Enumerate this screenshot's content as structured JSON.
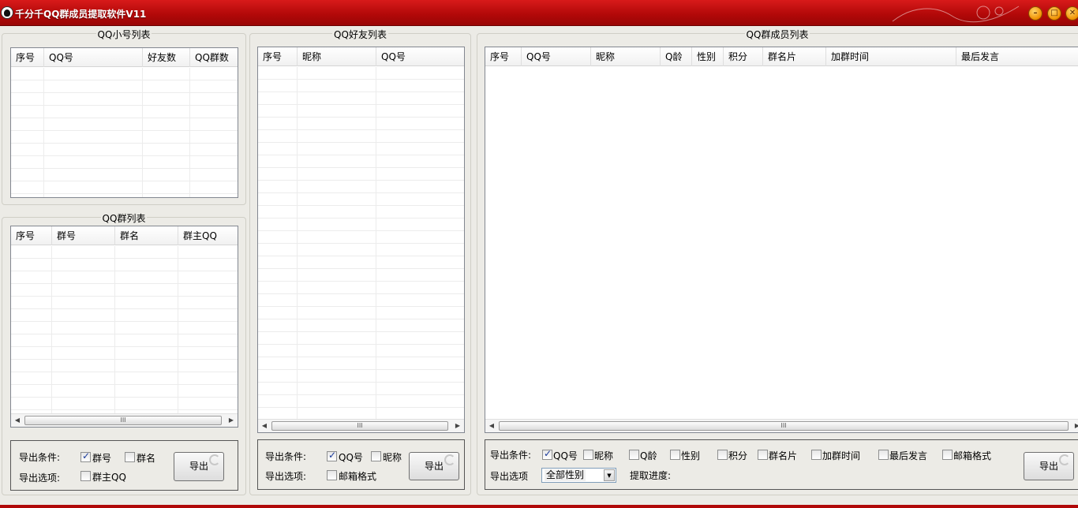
{
  "window": {
    "title": "千分千QQ群成员提取软件V11",
    "icon": "qq-penguin-icon",
    "accent": "#c00c0c"
  },
  "small_account_list": {
    "title": "QQ小号列表",
    "columns": [
      "序号",
      "QQ号",
      "好友数",
      "QQ群数"
    ],
    "rows": []
  },
  "group_list": {
    "title": "QQ群列表",
    "columns": [
      "序号",
      "群号",
      "群名",
      "群主QQ"
    ],
    "rows": [],
    "scroll_thumb": "III",
    "export": {
      "condition_label": "导出条件:",
      "option_label": "导出选项:",
      "checks": [
        {
          "label": "群号",
          "checked": true
        },
        {
          "label": "群名",
          "checked": false
        },
        {
          "label": "群主QQ",
          "checked": false
        }
      ],
      "button": "导出"
    }
  },
  "friend_list": {
    "title": "QQ好友列表",
    "columns": [
      "序号",
      "昵称",
      "QQ号"
    ],
    "rows": [],
    "scroll_thumb": "III",
    "export": {
      "condition_label": "导出条件:",
      "option_label": "导出选项:",
      "checks": [
        {
          "label": "QQ号",
          "checked": true
        },
        {
          "label": "昵称",
          "checked": false
        },
        {
          "label": "邮箱格式",
          "checked": false
        }
      ],
      "button": "导出"
    }
  },
  "member_list": {
    "title": "QQ群成员列表",
    "columns": [
      "序号",
      "QQ号",
      "昵称",
      "Q龄",
      "性别",
      "积分",
      "群名片",
      "加群时间",
      "最后发言"
    ],
    "rows": [],
    "scroll_thumb": "III",
    "export": {
      "condition_label": "导出条件:",
      "option_label": "导出选项",
      "checks": [
        {
          "label": "QQ号",
          "checked": true
        },
        {
          "label": "昵称",
          "checked": false
        },
        {
          "label": "Q龄",
          "checked": false
        },
        {
          "label": "性别",
          "checked": false
        },
        {
          "label": "积分",
          "checked": false
        },
        {
          "label": "群名片",
          "checked": false
        },
        {
          "label": "加群时间",
          "checked": false
        },
        {
          "label": "最后发言",
          "checked": false
        },
        {
          "label": "邮箱格式",
          "checked": false
        }
      ],
      "gender_select": "全部性别",
      "progress_label": "提取进度:",
      "button": "导出"
    }
  }
}
